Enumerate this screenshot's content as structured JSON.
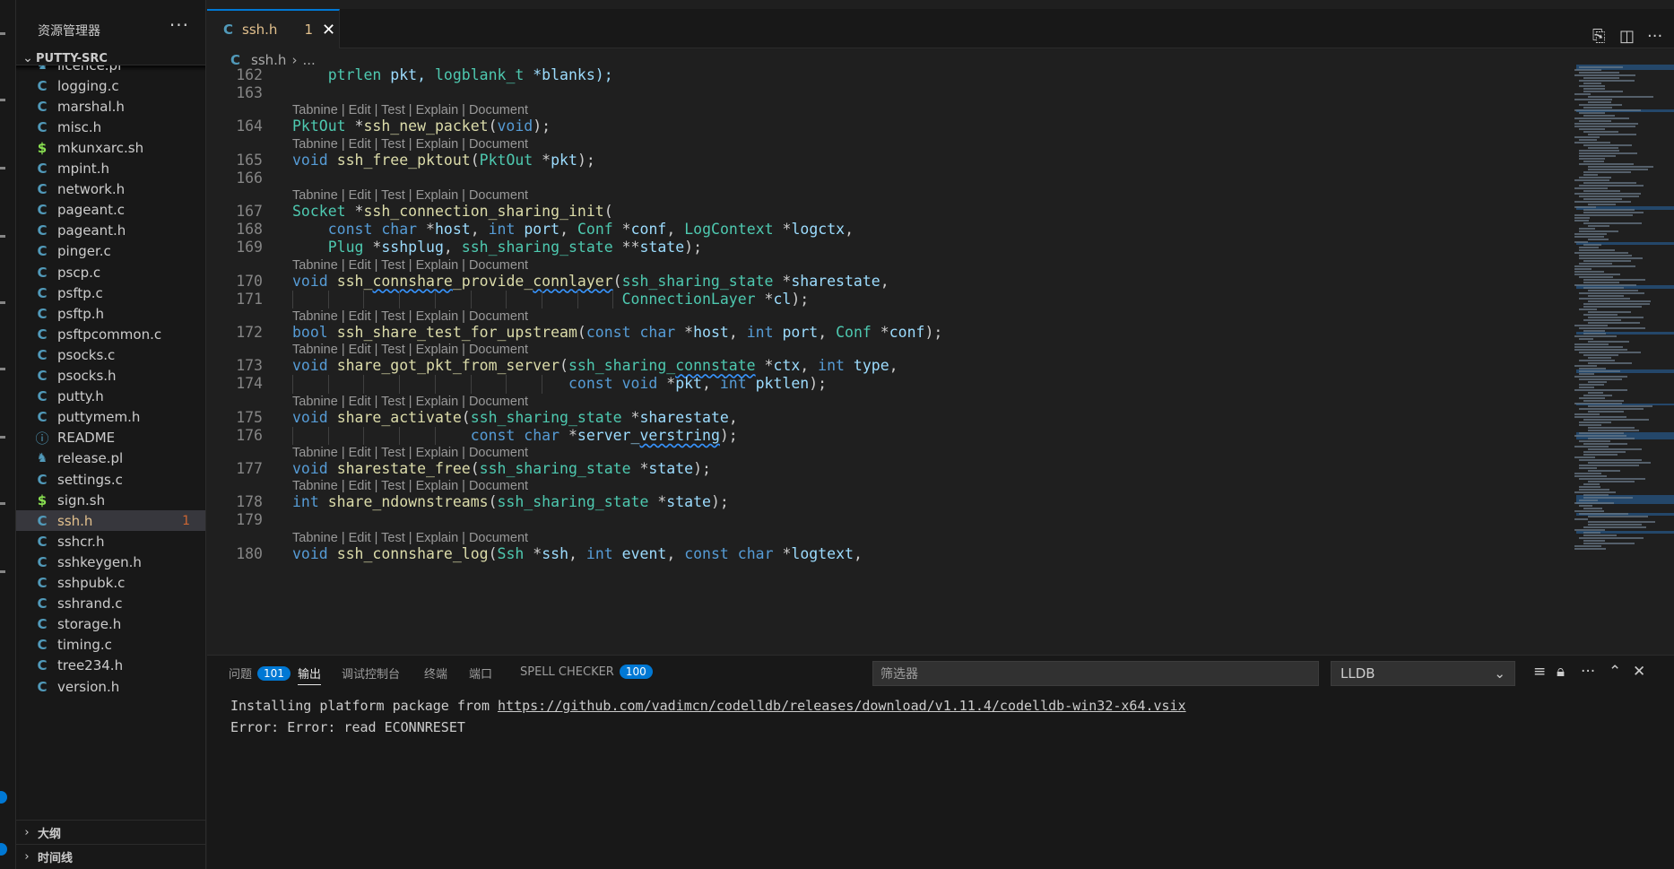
{
  "sidebar": {
    "title": "资源管理器",
    "more": "···",
    "folder": "PUTTY-SRC",
    "files": [
      {
        "name": "licence.pl",
        "icon": "perl-icon",
        "glyph": "🐪",
        "kind": "pl"
      },
      {
        "name": "logging.c",
        "icon": "c-file-icon",
        "glyph": "C",
        "kind": "c"
      },
      {
        "name": "marshal.h",
        "icon": "c-file-icon",
        "glyph": "C",
        "kind": "c"
      },
      {
        "name": "misc.h",
        "icon": "c-file-icon",
        "glyph": "C",
        "kind": "c"
      },
      {
        "name": "mkunxarc.sh",
        "icon": "shell-file-icon",
        "glyph": "$",
        "kind": "sh"
      },
      {
        "name": "mpint.h",
        "icon": "c-file-icon",
        "glyph": "C",
        "kind": "c"
      },
      {
        "name": "network.h",
        "icon": "c-file-icon",
        "glyph": "C",
        "kind": "c"
      },
      {
        "name": "pageant.c",
        "icon": "c-file-icon",
        "glyph": "C",
        "kind": "c"
      },
      {
        "name": "pageant.h",
        "icon": "c-file-icon",
        "glyph": "C",
        "kind": "c"
      },
      {
        "name": "pinger.c",
        "icon": "c-file-icon",
        "glyph": "C",
        "kind": "c"
      },
      {
        "name": "pscp.c",
        "icon": "c-file-icon",
        "glyph": "C",
        "kind": "c"
      },
      {
        "name": "psftp.c",
        "icon": "c-file-icon",
        "glyph": "C",
        "kind": "c"
      },
      {
        "name": "psftp.h",
        "icon": "c-file-icon",
        "glyph": "C",
        "kind": "c"
      },
      {
        "name": "psftpcommon.c",
        "icon": "c-file-icon",
        "glyph": "C",
        "kind": "c"
      },
      {
        "name": "psocks.c",
        "icon": "c-file-icon",
        "glyph": "C",
        "kind": "c"
      },
      {
        "name": "psocks.h",
        "icon": "c-file-icon",
        "glyph": "C",
        "kind": "c"
      },
      {
        "name": "putty.h",
        "icon": "c-file-icon",
        "glyph": "C",
        "kind": "c"
      },
      {
        "name": "puttymem.h",
        "icon": "c-file-icon",
        "glyph": "C",
        "kind": "c"
      },
      {
        "name": "README",
        "icon": "info-icon",
        "glyph": "ⓘ",
        "kind": "info"
      },
      {
        "name": "release.pl",
        "icon": "perl-icon",
        "glyph": "🐪",
        "kind": "pl"
      },
      {
        "name": "settings.c",
        "icon": "c-file-icon",
        "glyph": "C",
        "kind": "c"
      },
      {
        "name": "sign.sh",
        "icon": "shell-file-icon",
        "glyph": "$",
        "kind": "sh"
      },
      {
        "name": "ssh.h",
        "icon": "c-file-icon",
        "glyph": "C",
        "kind": "c",
        "active": true,
        "badge": "1"
      },
      {
        "name": "sshcr.h",
        "icon": "c-file-icon",
        "glyph": "C",
        "kind": "c"
      },
      {
        "name": "sshkeygen.h",
        "icon": "c-file-icon",
        "glyph": "C",
        "kind": "c"
      },
      {
        "name": "sshpubk.c",
        "icon": "c-file-icon",
        "glyph": "C",
        "kind": "c"
      },
      {
        "name": "sshrand.c",
        "icon": "c-file-icon",
        "glyph": "C",
        "kind": "c"
      },
      {
        "name": "storage.h",
        "icon": "c-file-icon",
        "glyph": "C",
        "kind": "c"
      },
      {
        "name": "timing.c",
        "icon": "c-file-icon",
        "glyph": "C",
        "kind": "c"
      },
      {
        "name": "tree234.h",
        "icon": "c-file-icon",
        "glyph": "C",
        "kind": "c"
      },
      {
        "name": "version.h",
        "icon": "c-file-icon",
        "glyph": "C",
        "kind": "c"
      }
    ],
    "outline": "大纲",
    "timeline": "时间线"
  },
  "editor": {
    "tab": {
      "icon": "C",
      "label": "ssh.h",
      "badge": "1",
      "close": "✕"
    },
    "breadcrumb": {
      "icon": "C",
      "file": "ssh.h",
      "sep": "›",
      "rest": "..."
    },
    "codelens": "Tabnine | Edit | Test | Explain | Document",
    "lines": [
      {
        "n": "162",
        "lens": false,
        "tokens": [
          [
            "    ",
            ""
          ],
          [
            "ptrlen",
            "ty"
          ],
          [
            " pkt, ",
            "va"
          ],
          [
            "logblank_t",
            "ty"
          ],
          [
            " *blanks);",
            "va"
          ]
        ]
      },
      {
        "n": "163",
        "lens": false,
        "tokens": []
      },
      {
        "n": "164",
        "lens": true,
        "tokens": [
          [
            "PktOut",
            "ty"
          ],
          [
            " *",
            "pu"
          ],
          [
            "ssh_new_packet",
            "fn"
          ],
          [
            "(",
            "pu"
          ],
          [
            "void",
            "kw"
          ],
          [
            ");",
            "pu"
          ]
        ]
      },
      {
        "n": "165",
        "lens": true,
        "tokens": [
          [
            "void",
            "kw"
          ],
          [
            " ",
            "pu"
          ],
          [
            "ssh_free_pktout",
            "fn"
          ],
          [
            "(",
            "pu"
          ],
          [
            "PktOut",
            "ty"
          ],
          [
            " *",
            "pu"
          ],
          [
            "pkt",
            "va"
          ],
          [
            ");",
            "pu"
          ]
        ]
      },
      {
        "n": "166",
        "lens": false,
        "tokens": []
      },
      {
        "n": "167",
        "lens": true,
        "tokens": [
          [
            "Socket",
            "ty"
          ],
          [
            " *",
            "pu"
          ],
          [
            "ssh_connection_sharing_init",
            "fn"
          ],
          [
            "(",
            "pu"
          ]
        ]
      },
      {
        "n": "168",
        "lens": false,
        "tokens": [
          [
            "    ",
            ""
          ],
          [
            "const",
            "kw"
          ],
          [
            " ",
            "pu"
          ],
          [
            "char",
            "kw"
          ],
          [
            " *",
            "pu"
          ],
          [
            "host",
            "va"
          ],
          [
            ", ",
            "pu"
          ],
          [
            "int",
            "kw"
          ],
          [
            " ",
            "pu"
          ],
          [
            "port",
            "va"
          ],
          [
            ", ",
            "pu"
          ],
          [
            "Conf",
            "ty"
          ],
          [
            " *",
            "pu"
          ],
          [
            "conf",
            "va"
          ],
          [
            ", ",
            "pu"
          ],
          [
            "LogContext",
            "ty"
          ],
          [
            " *",
            "pu"
          ],
          [
            "logctx",
            "va"
          ],
          [
            ",",
            "pu"
          ]
        ]
      },
      {
        "n": "169",
        "lens": false,
        "tokens": [
          [
            "    ",
            ""
          ],
          [
            "Plug",
            "ty"
          ],
          [
            " *",
            "pu"
          ],
          [
            "sshplug",
            "va"
          ],
          [
            ", ",
            "pu"
          ],
          [
            "ssh_sharing_state",
            "ty"
          ],
          [
            " **",
            "pu"
          ],
          [
            "state",
            "va"
          ],
          [
            ");",
            "pu"
          ]
        ]
      },
      {
        "n": "170",
        "lens": true,
        "tokens": [
          [
            "void",
            "kw"
          ],
          [
            " ",
            "pu"
          ],
          [
            "ssh_",
            "fn"
          ],
          [
            "connshare",
            "fn squig"
          ],
          [
            "_provide_",
            "fn"
          ],
          [
            "connlayer",
            "fn squig"
          ],
          [
            "(",
            "pu"
          ],
          [
            "ssh_sharing_state",
            "ty"
          ],
          [
            " *",
            "pu"
          ],
          [
            "sharestate",
            "va"
          ],
          [
            ",",
            "pu"
          ]
        ]
      },
      {
        "n": "171",
        "lens": false,
        "tokens": [
          [
            "                                     ",
            ""
          ],
          [
            "ConnectionLayer",
            "ty"
          ],
          [
            " *",
            "pu"
          ],
          [
            "cl",
            "va"
          ],
          [
            ");",
            "pu"
          ]
        ]
      },
      {
        "n": "172",
        "lens": true,
        "tokens": [
          [
            "bool",
            "kw"
          ],
          [
            " ",
            "pu"
          ],
          [
            "ssh_share_test_for_upstream",
            "fn"
          ],
          [
            "(",
            "pu"
          ],
          [
            "const",
            "kw"
          ],
          [
            " ",
            "pu"
          ],
          [
            "char",
            "kw"
          ],
          [
            " *",
            "pu"
          ],
          [
            "host",
            "va"
          ],
          [
            ", ",
            "pu"
          ],
          [
            "int",
            "kw"
          ],
          [
            " ",
            "pu"
          ],
          [
            "port",
            "va"
          ],
          [
            ", ",
            "pu"
          ],
          [
            "Conf",
            "ty"
          ],
          [
            " *",
            "pu"
          ],
          [
            "conf",
            "va"
          ],
          [
            ");",
            "pu"
          ]
        ]
      },
      {
        "n": "173",
        "lens": true,
        "tokens": [
          [
            "void",
            "kw"
          ],
          [
            " ",
            "pu"
          ],
          [
            "share_got_pkt_from_server",
            "fn"
          ],
          [
            "(",
            "pu"
          ],
          [
            "ssh_sharing_",
            "ty"
          ],
          [
            "connstate",
            "ty squig"
          ],
          [
            " *",
            "pu"
          ],
          [
            "ctx",
            "va"
          ],
          [
            ", ",
            "pu"
          ],
          [
            "int",
            "kw"
          ],
          [
            " ",
            "pu"
          ],
          [
            "type",
            "va"
          ],
          [
            ",",
            "pu"
          ]
        ]
      },
      {
        "n": "174",
        "lens": false,
        "tokens": [
          [
            "                               ",
            ""
          ],
          [
            "const",
            "kw"
          ],
          [
            " ",
            "pu"
          ],
          [
            "void",
            "kw"
          ],
          [
            " *",
            "pu"
          ],
          [
            "pkt",
            "va"
          ],
          [
            ", ",
            "pu"
          ],
          [
            "int",
            "kw"
          ],
          [
            " ",
            "pu"
          ],
          [
            "pktlen",
            "va"
          ],
          [
            ");",
            "pu"
          ]
        ]
      },
      {
        "n": "175",
        "lens": true,
        "tokens": [
          [
            "void",
            "kw"
          ],
          [
            " ",
            "pu"
          ],
          [
            "share_activate",
            "fn"
          ],
          [
            "(",
            "pu"
          ],
          [
            "ssh_sharing_state",
            "ty"
          ],
          [
            " *",
            "pu"
          ],
          [
            "sharestate",
            "va"
          ],
          [
            ",",
            "pu"
          ]
        ]
      },
      {
        "n": "176",
        "lens": false,
        "tokens": [
          [
            "                    ",
            ""
          ],
          [
            "const",
            "kw"
          ],
          [
            " ",
            "pu"
          ],
          [
            "char",
            "kw"
          ],
          [
            " *",
            "pu"
          ],
          [
            "server_",
            "va"
          ],
          [
            "verstring",
            "va squig"
          ],
          [
            ");",
            "pu"
          ]
        ]
      },
      {
        "n": "177",
        "lens": true,
        "tokens": [
          [
            "void",
            "kw"
          ],
          [
            " ",
            "pu"
          ],
          [
            "sharestate_free",
            "fn"
          ],
          [
            "(",
            "pu"
          ],
          [
            "ssh_sharing_state",
            "ty"
          ],
          [
            " *",
            "pu"
          ],
          [
            "state",
            "va"
          ],
          [
            ");",
            "pu"
          ]
        ]
      },
      {
        "n": "178",
        "lens": true,
        "tokens": [
          [
            "int",
            "kw"
          ],
          [
            " ",
            "pu"
          ],
          [
            "share_ndownstreams",
            "fn"
          ],
          [
            "(",
            "pu"
          ],
          [
            "ssh_sharing_state",
            "ty"
          ],
          [
            " *",
            "pu"
          ],
          [
            "state",
            "va"
          ],
          [
            ");",
            "pu"
          ]
        ]
      },
      {
        "n": "179",
        "lens": false,
        "tokens": []
      },
      {
        "n": "180",
        "lens": true,
        "tokens": [
          [
            "void",
            "kw"
          ],
          [
            " ",
            "pu"
          ],
          [
            "ssh_connshare_log",
            "fn"
          ],
          [
            "(",
            "pu"
          ],
          [
            "Ssh",
            "ty"
          ],
          [
            " *",
            "pu"
          ],
          [
            "ssh",
            "va"
          ],
          [
            ", ",
            "pu"
          ],
          [
            "int",
            "kw"
          ],
          [
            " ",
            "pu"
          ],
          [
            "event",
            "va"
          ],
          [
            ", ",
            "pu"
          ],
          [
            "const",
            "kw"
          ],
          [
            " ",
            "pu"
          ],
          [
            "char",
            "kw"
          ],
          [
            " *",
            "pu"
          ],
          [
            "logtext",
            "va"
          ],
          [
            ",",
            "pu"
          ]
        ]
      }
    ]
  },
  "panel": {
    "tabs": [
      {
        "label": "问题",
        "badge": "101"
      },
      {
        "label": "输出",
        "active": true
      },
      {
        "label": "调试控制台"
      },
      {
        "label": "终端"
      },
      {
        "label": "端口"
      },
      {
        "label": "SPELL CHECKER",
        "badge": "100"
      }
    ],
    "filter_placeholder": "筛选器",
    "channel": "LLDB",
    "output": {
      "line1_prefix": "Installing platform package from ",
      "line1_link": "https://github.com/vadimcn/codelldb/releases/download/v1.11.4/codelldb-win32-x64.vsix",
      "line2": "Error: Error: read ECONNRESET"
    }
  },
  "colors": {
    "accent": "#0078d4",
    "modified": "#e2c08d",
    "c_icon": "#519aba"
  }
}
